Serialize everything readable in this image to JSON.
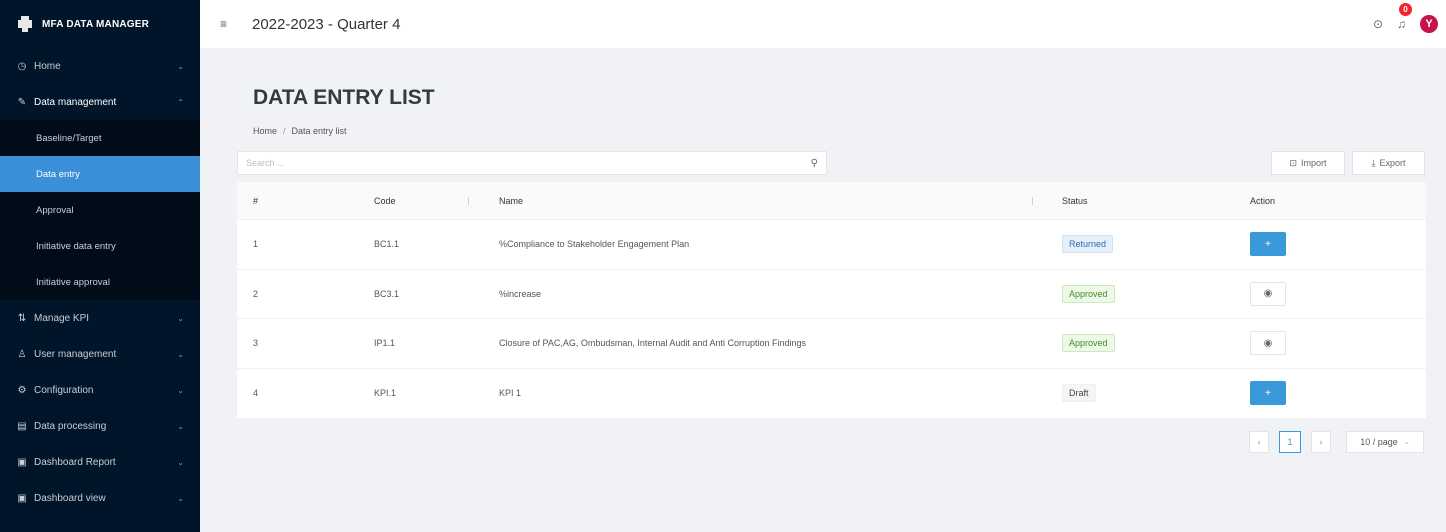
{
  "app": {
    "title": "MFA DATA MANAGER"
  },
  "header": {
    "period": "2022-2023 - Quarter 4",
    "notification_count": "0",
    "avatar_initial": "Y"
  },
  "sidebar": {
    "items": [
      {
        "label": "Home",
        "icon": "home-icon"
      },
      {
        "label": "Data management",
        "icon": "edit-icon",
        "open": true,
        "children": [
          "Baseline/Target",
          "Data entry",
          "Approval",
          "Initiative data entry",
          "Initiative approval"
        ],
        "active_child": "Data entry"
      },
      {
        "label": "Manage KPI",
        "icon": "kpi-icon"
      },
      {
        "label": "User management",
        "icon": "user-icon"
      },
      {
        "label": "Configuration",
        "icon": "gear-icon"
      },
      {
        "label": "Data processing",
        "icon": "database-icon"
      },
      {
        "label": "Dashboard Report",
        "icon": "report-icon"
      },
      {
        "label": "Dashboard view",
        "icon": "dashboard-icon"
      }
    ]
  },
  "page": {
    "title": "DATA ENTRY LIST",
    "breadcrumb": [
      "Home",
      "Data entry list"
    ],
    "search_placeholder": "Search ...",
    "import_label": "Import",
    "export_label": "Export"
  },
  "table": {
    "columns": [
      "#",
      "Code",
      "Name",
      "Status",
      "Action"
    ],
    "rows": [
      {
        "idx": "1",
        "code": "BC1.1",
        "name": "%Compliance to Stakeholder Engagement Plan",
        "status": "Returned",
        "action": "add"
      },
      {
        "idx": "2",
        "code": "BC3.1",
        "name": "%increase",
        "status": "Approved",
        "action": "view"
      },
      {
        "idx": "3",
        "code": "IP1.1",
        "name": "Closure of PAC,AG, Ombudsman, Internal Audit and Anti Corruption Findings",
        "status": "Approved",
        "action": "view"
      },
      {
        "idx": "4",
        "code": "KPI.1",
        "name": "KPI 1",
        "status": "Draft",
        "action": "add"
      }
    ]
  },
  "pagination": {
    "current_page": "1",
    "page_size": "10 / page"
  },
  "colors": {
    "sidebar_bg": "#001529",
    "accent": "#3a9ad9",
    "badge": "#f5222d",
    "avatar": "#c7114a"
  }
}
